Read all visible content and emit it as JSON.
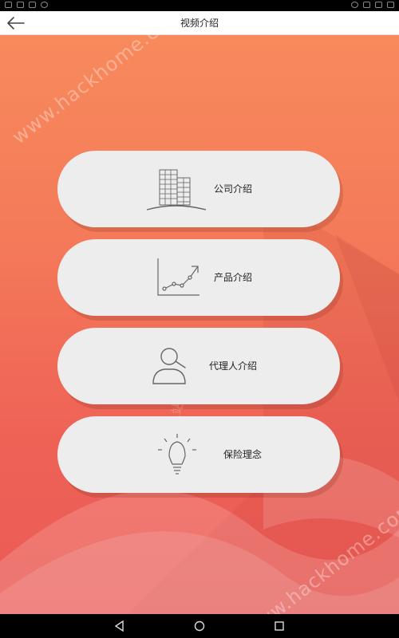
{
  "header": {
    "title": "视频介绍"
  },
  "menu": [
    {
      "label": "公司介绍",
      "icon": "buildings-icon"
    },
    {
      "label": "产品介绍",
      "icon": "chart-trend-icon"
    },
    {
      "label": "代理人介绍",
      "icon": "agent-search-icon"
    },
    {
      "label": "保险理念",
      "icon": "lightbulb-icon"
    }
  ],
  "watermark": {
    "text": "www.hackhome.com",
    "text2": "网侠手机站"
  },
  "nav": {
    "back": "back-icon",
    "home": "home-icon",
    "recents": "recents-icon"
  }
}
